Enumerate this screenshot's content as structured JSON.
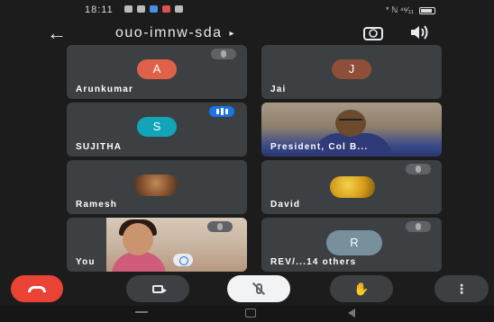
{
  "status": {
    "time": "18:11",
    "right": "* ℕ ⁴⁶⁄₁₁"
  },
  "topbar": {
    "meeting_code": "ouo-imnw-sda",
    "caret": "▸"
  },
  "tiles": {
    "arunkumar": {
      "name": "Arunkumar",
      "initial": "A",
      "color": "#e0614a"
    },
    "jai": {
      "name": "Jai",
      "initial": "J",
      "color": "#8d4e3a"
    },
    "sujitha": {
      "name": "SUJITHA",
      "initial": "S",
      "color": "#12a5b8"
    },
    "president": {
      "name": "President, Col B..."
    },
    "ramesh": {
      "name": "Ramesh"
    },
    "david": {
      "name": "David"
    },
    "you": {
      "name": "You"
    },
    "others": {
      "name": "REV/...14 others",
      "initial": "R"
    }
  },
  "controls": {
    "end_call": "end-call",
    "camera": "camera-off",
    "mic": "mic-muted",
    "hand": "✋",
    "more": "⋮"
  }
}
